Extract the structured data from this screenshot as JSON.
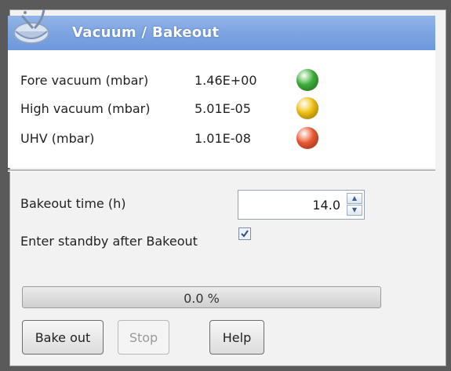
{
  "window": {
    "title": "Vacuum / Bakeout",
    "icon": "app-logo-icon"
  },
  "readings": [
    {
      "label": "Fore vacuum (mbar)",
      "value": "1.46E+00",
      "status_color": "#3fb13a"
    },
    {
      "label": "High vacuum (mbar)",
      "value": "5.01E-05",
      "status_color": "#f5c20f"
    },
    {
      "label": "UHV (mbar)",
      "value": "1.01E-08",
      "status_color": "#ee5a32"
    }
  ],
  "bakeout": {
    "time_label": "Bakeout time (h)",
    "time_value": "14.0",
    "standby_label": "Enter standby after Bakeout",
    "standby_checked": true
  },
  "progress": {
    "text": "0.0 %",
    "fraction": 0.0
  },
  "buttons": {
    "bake_out": "Bake out",
    "stop": "Stop",
    "help": "Help"
  }
}
